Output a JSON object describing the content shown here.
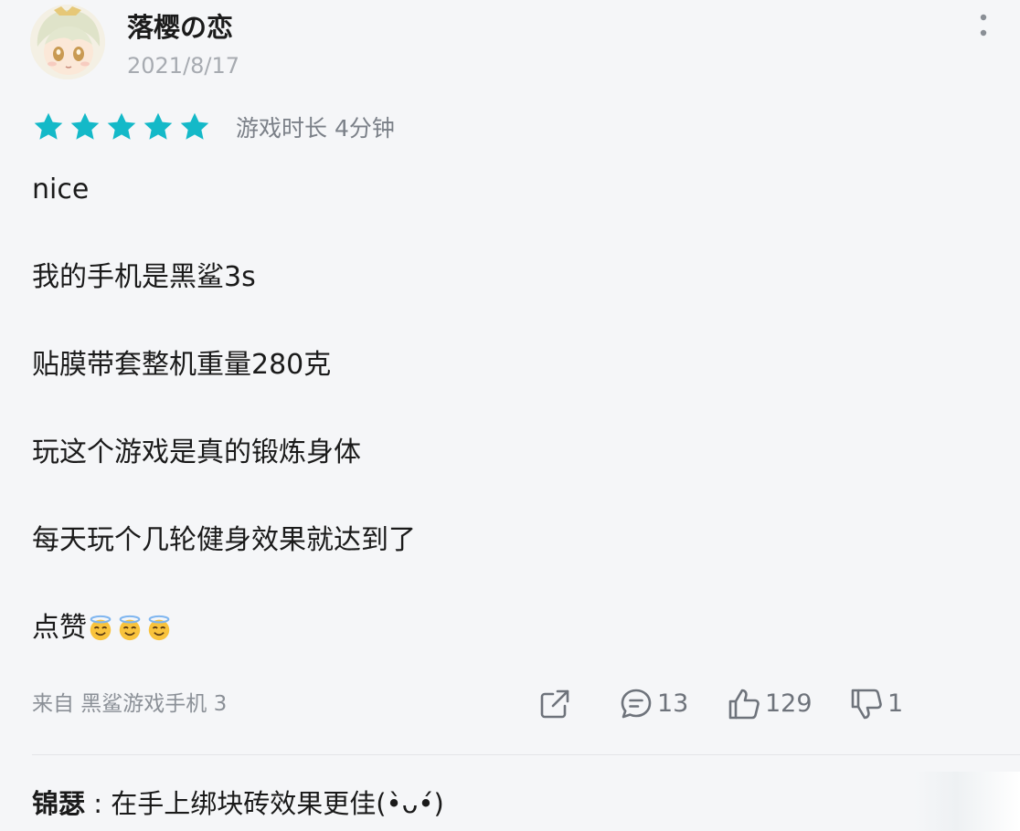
{
  "user": {
    "name": "落樱の恋",
    "date": "2021/8/17"
  },
  "rating": {
    "stars": 5,
    "max": 5,
    "star_color": "#14b9c8",
    "playtime": "游戏时长 4分钟"
  },
  "review": {
    "lines": [
      "nice",
      "我的手机是黑鲨3s",
      "贴膜带套整机重量280克",
      "玩这个游戏是真的锻炼身体",
      "每天玩个几轮健身效果就达到了",
      "点赞"
    ],
    "emoji": [
      "smiling-face-with-halo",
      "smiling-face-with-halo",
      "smiling-face-with-halo"
    ]
  },
  "footer": {
    "device": "来自 黑鲨游戏手机 3",
    "comment_count": "13",
    "like_count": "129",
    "dislike_count": "1"
  },
  "reply": {
    "author": "锦瑟",
    "separator": " : ",
    "text": "在手上绑块砖效果更佳(•̀ᴗ•́)"
  },
  "colors": {
    "background": "#f5f6f8",
    "accent": "#14b9c8",
    "muted_text": "#a7abb1",
    "icon": "#6e737b"
  }
}
